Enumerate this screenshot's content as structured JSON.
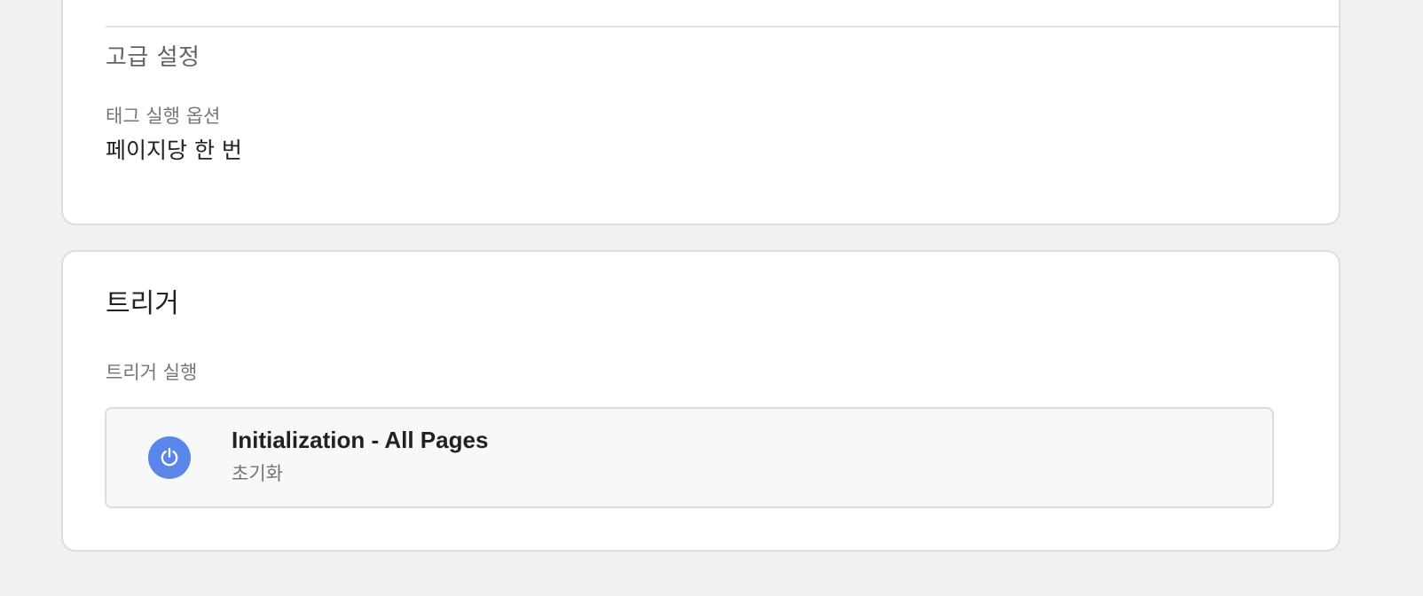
{
  "advanced_settings": {
    "heading": "고급 설정",
    "tag_firing_option_label": "태그 실행 옵션",
    "tag_firing_option_value": "페이지당 한 번"
  },
  "triggers": {
    "heading": "트리거",
    "firing_label": "트리거 실행",
    "items": [
      {
        "name": "Initialization - All Pages",
        "type": "초기화",
        "icon": "power-icon",
        "icon_color": "#5a85e9"
      }
    ]
  },
  "colors": {
    "background": "#f0f1f3",
    "card": "#ffffff",
    "trigger_row_bg": "#f7f8fa"
  }
}
